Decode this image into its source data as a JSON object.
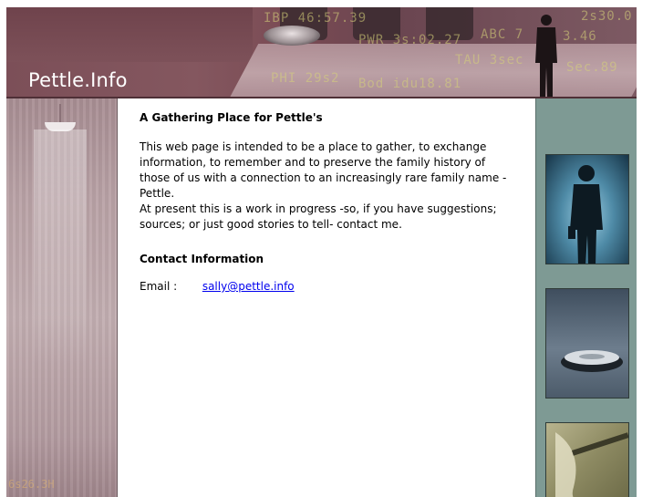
{
  "site": {
    "title": "Pettle.Info"
  },
  "banner": {
    "tickers": [
      "IBP 46:57.39",
      "PWR 3s:02.27",
      "ABC 7",
      "2s30.0",
      "3.46",
      "TAU 3sec",
      "Sec.89",
      "PHI 29s2",
      "Bod idu18.81"
    ],
    "colors": {
      "banner": "#7c4f58",
      "title_text": "#ffffff"
    }
  },
  "main": {
    "heading": "A Gathering Place for Pettle's",
    "paragraph_1": "This web page is intended to be a place to gather, to exchange information, to remember and to preserve the family history of those of us with a connection to an increasingly rare family name - Pettle.",
    "paragraph_2": "At present this is a work in progress -so, if you have suggestions; sources; or just good stories to tell- contact me.",
    "contact_heading": "Contact Information",
    "email_label": "Email :",
    "email_value": "sally@pettle.info"
  },
  "left_column": {
    "ticker": "6s26.3H"
  },
  "right_column": {
    "images": [
      "businessman-silhouette",
      "conference-phone",
      "hand-writing"
    ],
    "colors": {
      "background": "#7e9a94"
    }
  },
  "colors": {
    "link": "#0000ee",
    "text": "#000000"
  }
}
